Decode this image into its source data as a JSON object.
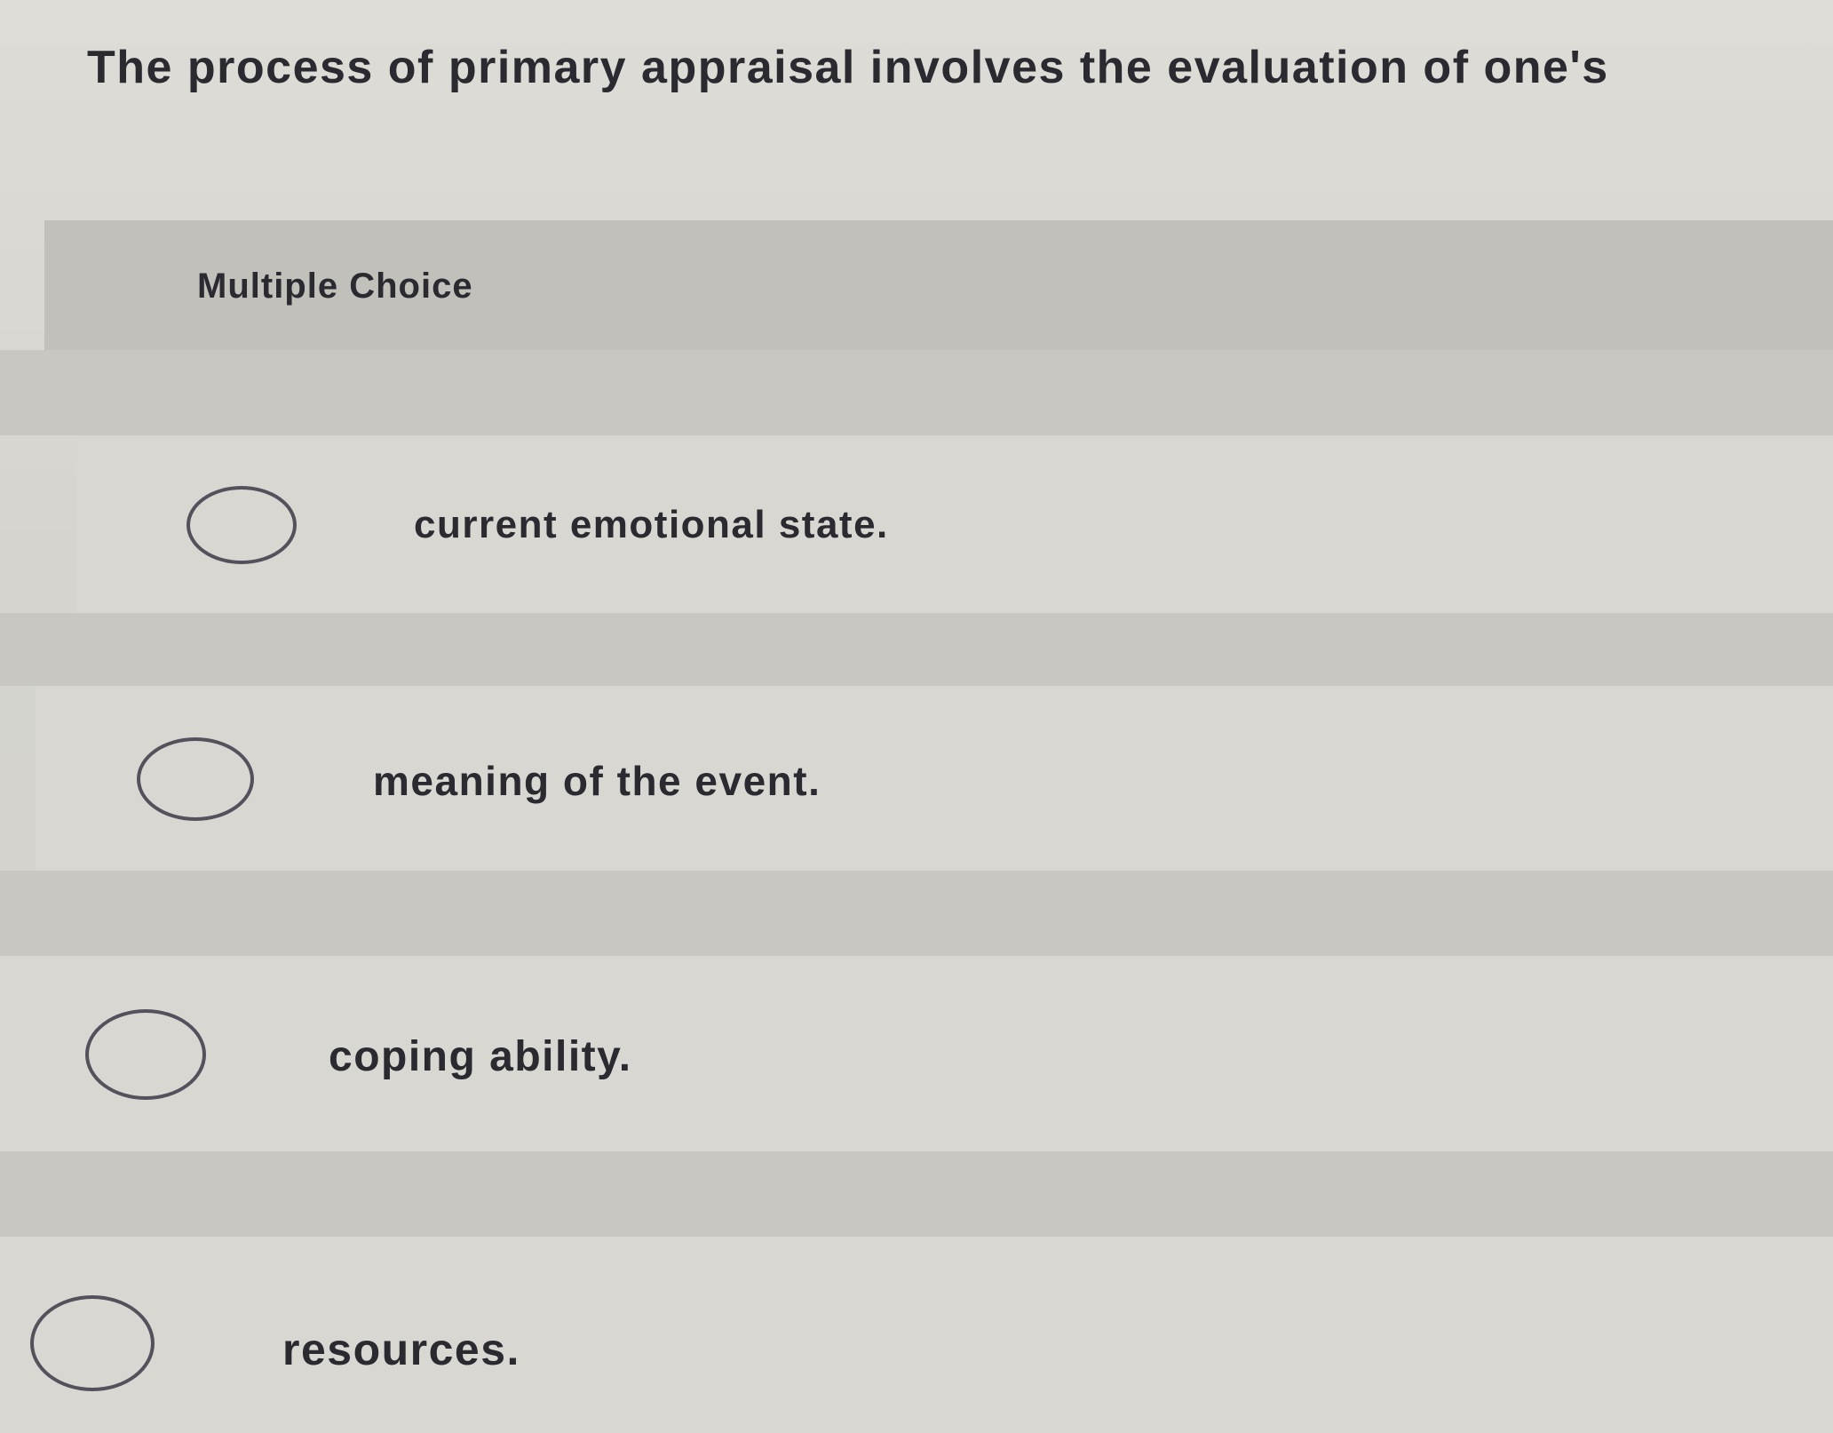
{
  "question": {
    "text": "The process of primary appraisal involves the evaluation of one's"
  },
  "question_type": "Multiple Choice",
  "options": [
    {
      "label": "current emotional state."
    },
    {
      "label": "meaning of the event."
    },
    {
      "label": "coping ability."
    },
    {
      "label": "resources."
    }
  ]
}
